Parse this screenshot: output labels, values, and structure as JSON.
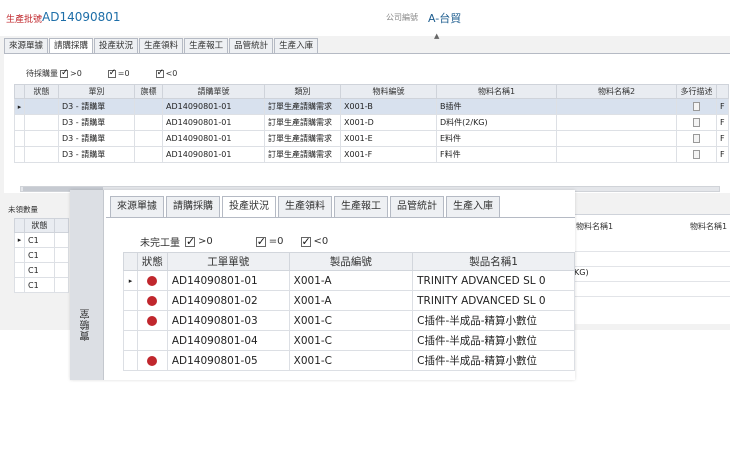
{
  "header": {
    "batch_label": "生產批號",
    "batch_value": "AD14090801",
    "company_label": "公司編號",
    "company_value": "A-台貿"
  },
  "tabs": [
    "來源單據",
    "請購採購",
    "投產狀況",
    "生產領料",
    "生產報工",
    "品管統計",
    "生產入庫"
  ],
  "back_panel": {
    "filter_label": "待採購量",
    "filters": [
      ">0",
      "=0",
      "<0"
    ],
    "columns": [
      "狀態",
      "單別",
      "旗標",
      "請購單號",
      "類別",
      "物料編號",
      "物料名稱1",
      "物料名稱2",
      "多行描述"
    ],
    "rows": [
      {
        "type": "D3 - 請購單",
        "order": "AD14090801-01",
        "category": "訂單生產請購需求",
        "item_no": "X001-B",
        "item_name": "B插件",
        "extra": "F"
      },
      {
        "type": "D3 - 請購單",
        "order": "AD14090801-01",
        "category": "訂單生產請購需求",
        "item_no": "X001-D",
        "item_name": "D料件(2/KG)",
        "extra": "F"
      },
      {
        "type": "D3 - 請購單",
        "order": "AD14090801-01",
        "category": "訂單生產請購需求",
        "item_no": "X001-E",
        "item_name": "E料件",
        "extra": "F"
      },
      {
        "type": "D3 - 請購單",
        "order": "AD14090801-01",
        "category": "訂單生產請購需求",
        "item_no": "X001-F",
        "item_name": "F料件",
        "extra": "F"
      }
    ],
    "lower_label": "未領數量",
    "lower_status_col": "狀態",
    "lower_rows": [
      "C1",
      "C1",
      "C1",
      "C1"
    ],
    "peek_headers": [
      "物料名稱1",
      "物料名稱1"
    ],
    "peek_cell": "KG)"
  },
  "front": {
    "sidebar_label": "實驗室",
    "active_tab_index": 2,
    "filter_label": "未完工量",
    "filters": [
      ">0",
      "=0",
      "<0"
    ],
    "columns": [
      "狀態",
      "工單單號",
      "製品編號",
      "製品名稱1"
    ],
    "rows": [
      {
        "order": "AD14090801-01",
        "product_no": "X001-A",
        "product_name": "TRINITY ADVANCED SL 0",
        "dot": true
      },
      {
        "order": "AD14090801-02",
        "product_no": "X001-A",
        "product_name": "TRINITY ADVANCED SL 0",
        "dot": true
      },
      {
        "order": "AD14090801-03",
        "product_no": "X001-C",
        "product_name": "C插件-半成品-精算小數位",
        "dot": true
      },
      {
        "order": "AD14090801-04",
        "product_no": "X001-C",
        "product_name": "C插件-半成品-精算小數位",
        "dot": false
      },
      {
        "order": "AD14090801-05",
        "product_no": "X001-C",
        "product_name": "C插件-半成品-精算小數位",
        "dot": true
      }
    ],
    "selected_row": 0,
    "status_color": "#c0272d"
  }
}
